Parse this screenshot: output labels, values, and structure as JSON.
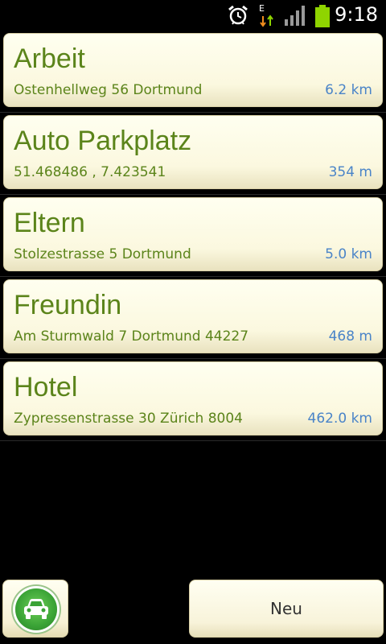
{
  "status_bar": {
    "time": "9:18",
    "data_indicator": "E",
    "icons": [
      "alarm-icon",
      "data-arrows-icon",
      "signal-icon",
      "battery-icon"
    ],
    "battery_color": "#8fd400"
  },
  "locations": [
    {
      "name": "Arbeit",
      "address": "Ostenhellweg 56 Dortmund",
      "distance": "6.2 km"
    },
    {
      "name": "Auto Parkplatz",
      "address": "51.468486 , 7.423541",
      "distance": "354 m"
    },
    {
      "name": "Eltern",
      "address": "Stolzestrasse 5 Dortmund",
      "distance": "5.0 km"
    },
    {
      "name": "Freundin",
      "address": "Am Sturmwald 7 Dortmund 44227",
      "distance": "468 m"
    },
    {
      "name": "Hotel",
      "address": "Zypressenstrasse 30 Zürich 8004",
      "distance": "462.0 km"
    }
  ],
  "toolbar": {
    "car_icon": "car-icon",
    "new_label": "Neu"
  },
  "colors": {
    "title_green": "#5b841a",
    "distance_blue": "#4a84c8",
    "card_bg": "#fbf8df"
  }
}
